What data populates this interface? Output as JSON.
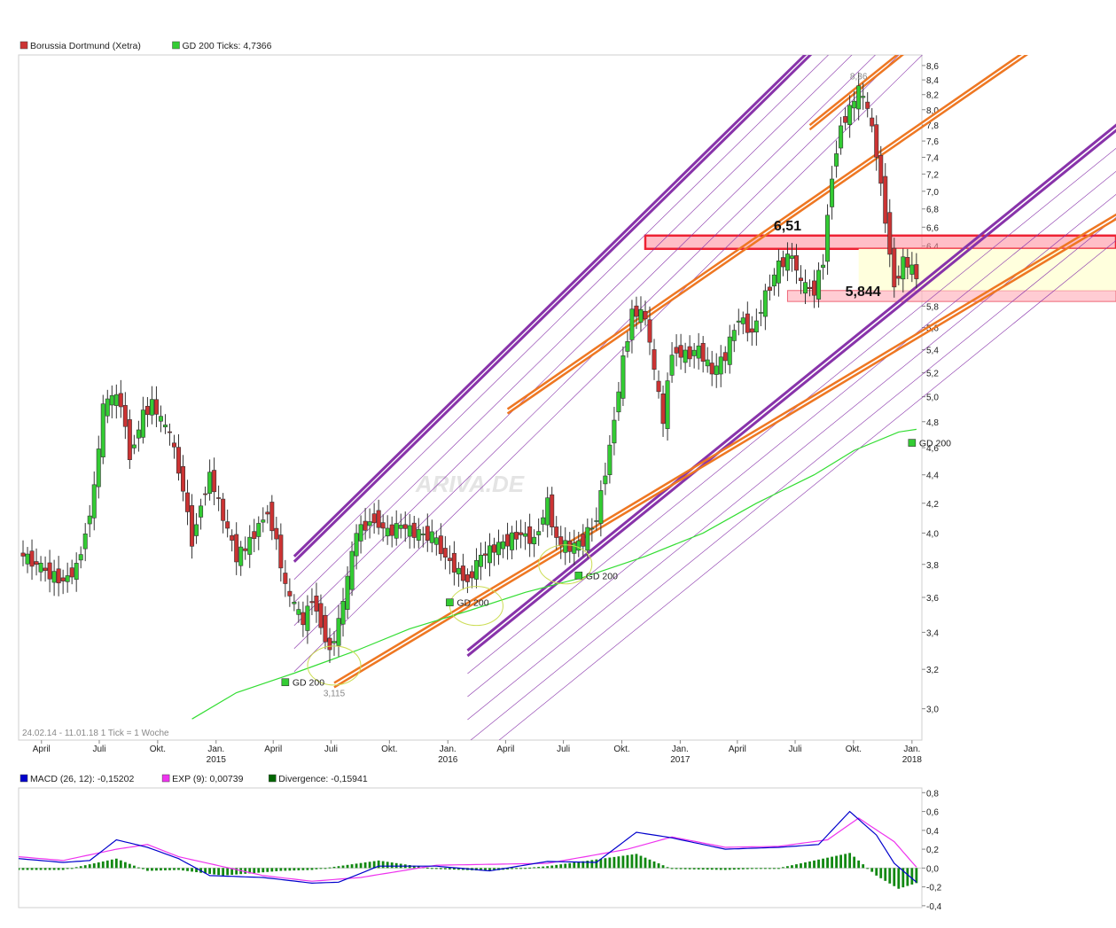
{
  "main_legend": [
    {
      "label": "Borussia Dortmund (Xetra)",
      "color": "#cc3333"
    },
    {
      "label": "GD 200 Ticks: 4,7366",
      "color": "#33cc33"
    }
  ],
  "macd_legend": [
    {
      "label": "MACD (26, 12): -0,15202",
      "color": "#0000cc"
    },
    {
      "label": "EXP (9): 0,00739",
      "color": "#ee33ee"
    },
    {
      "label": "Divergence: -0,15941",
      "color": "#006600"
    }
  ],
  "watermark": "ARIVA.DE",
  "footer_note": "24.02.14 - 11.01.18   1 Tick = 1 Woche",
  "colors": {
    "up": "#33cc33",
    "down": "#cc3333",
    "ma": "#33dd33",
    "channel": "#8833aa",
    "support": "#ee7722",
    "zone_red": "#ee2233",
    "zone_yellow": "#ffffdd",
    "macd": "#0000cc",
    "signal": "#ee33ee",
    "divergence": "#118811"
  },
  "chart_data": [
    {
      "type": "candlestick",
      "title": "Borussia Dortmund (Xetra)",
      "x_type": "weekly",
      "x_range": [
        "2014-02-24",
        "2018-01-11"
      ],
      "ylim": [
        2.85,
        8.75
      ],
      "y_scale": "log",
      "y_ticks": [
        "3,0",
        "3,2",
        "3,4",
        "3,6",
        "3,8",
        "4,0",
        "4,2",
        "4,4",
        "4,6",
        "4,8",
        "5,0",
        "5,2",
        "5,4",
        "5,6",
        "5,8",
        "6,0",
        "6,2",
        "6,4",
        "6,6",
        "6,8",
        "7,0",
        "7,2",
        "7,4",
        "7,6",
        "7,8",
        "8,0",
        "8,2",
        "8,4",
        "8,6"
      ],
      "x_ticks": [
        {
          "date": "2014-04-01",
          "label": "April",
          "year": ""
        },
        {
          "date": "2014-07-01",
          "label": "Juli",
          "year": ""
        },
        {
          "date": "2014-10-01",
          "label": "Okt.",
          "year": ""
        },
        {
          "date": "2015-01-01",
          "label": "Jan.",
          "year": "2015"
        },
        {
          "date": "2015-04-01",
          "label": "April",
          "year": ""
        },
        {
          "date": "2015-07-01",
          "label": "Juli",
          "year": ""
        },
        {
          "date": "2015-10-01",
          "label": "Okt.",
          "year": ""
        },
        {
          "date": "2016-01-01",
          "label": "Jan.",
          "year": "2016"
        },
        {
          "date": "2016-04-01",
          "label": "April",
          "year": ""
        },
        {
          "date": "2016-07-01",
          "label": "Juli",
          "year": ""
        },
        {
          "date": "2016-10-01",
          "label": "Okt.",
          "year": ""
        },
        {
          "date": "2017-01-01",
          "label": "Jan.",
          "year": "2017"
        },
        {
          "date": "2017-04-01",
          "label": "April",
          "year": ""
        },
        {
          "date": "2017-07-01",
          "label": "Juli",
          "year": ""
        },
        {
          "date": "2017-10-01",
          "label": "Okt.",
          "year": ""
        },
        {
          "date": "2018-01-01",
          "label": "Jan.",
          "year": "2018"
        }
      ],
      "series": [
        {
          "name": "Borussia Dortmund (Xetra)",
          "kind": "close",
          "points": [
            [
              "2014-02-24",
              3.87
            ],
            [
              "2014-03-24",
              3.8
            ],
            [
              "2014-04-14",
              3.74
            ],
            [
              "2014-05-05",
              3.7
            ],
            [
              "2014-05-26",
              3.78
            ],
            [
              "2014-06-09",
              4.0
            ],
            [
              "2014-06-23",
              4.3
            ],
            [
              "2014-07-07",
              4.9
            ],
            [
              "2014-07-21",
              5.0
            ],
            [
              "2014-08-04",
              4.95
            ],
            [
              "2014-08-18",
              4.55
            ],
            [
              "2014-09-08",
              4.85
            ],
            [
              "2014-09-22",
              4.95
            ],
            [
              "2014-10-06",
              4.8
            ],
            [
              "2014-10-20",
              4.7
            ],
            [
              "2014-11-10",
              4.3
            ],
            [
              "2014-11-24",
              3.95
            ],
            [
              "2014-12-08",
              4.2
            ],
            [
              "2014-12-22",
              4.4
            ],
            [
              "2015-01-12",
              4.1
            ],
            [
              "2015-02-02",
              3.85
            ],
            [
              "2015-02-16",
              3.9
            ],
            [
              "2015-03-09",
              4.05
            ],
            [
              "2015-03-23",
              4.15
            ],
            [
              "2015-04-06",
              3.95
            ],
            [
              "2015-04-20",
              3.65
            ],
            [
              "2015-05-04",
              3.55
            ],
            [
              "2015-05-18",
              3.45
            ],
            [
              "2015-06-01",
              3.6
            ],
            [
              "2015-06-15",
              3.45
            ],
            [
              "2015-06-29",
              3.3
            ],
            [
              "2015-07-13",
              3.45
            ],
            [
              "2015-07-27",
              3.7
            ],
            [
              "2015-08-10",
              4.0
            ],
            [
              "2015-08-24",
              4.05
            ],
            [
              "2015-09-07",
              4.1
            ],
            [
              "2015-09-28",
              4.0
            ],
            [
              "2015-10-19",
              4.05
            ],
            [
              "2015-11-09",
              4.0
            ],
            [
              "2015-12-07",
              3.98
            ],
            [
              "2015-12-28",
              3.85
            ],
            [
              "2016-01-18",
              3.75
            ],
            [
              "2016-02-01",
              3.7
            ],
            [
              "2016-02-22",
              3.85
            ],
            [
              "2016-03-14",
              3.9
            ],
            [
              "2016-04-04",
              3.95
            ],
            [
              "2016-04-25",
              4.0
            ],
            [
              "2016-05-16",
              3.95
            ],
            [
              "2016-06-06",
              4.2
            ],
            [
              "2016-06-20",
              3.95
            ],
            [
              "2016-07-11",
              3.9
            ],
            [
              "2016-08-01",
              3.95
            ],
            [
              "2016-08-22",
              4.1
            ],
            [
              "2016-09-12",
              4.6
            ],
            [
              "2016-10-03",
              5.3
            ],
            [
              "2016-10-17",
              5.75
            ],
            [
              "2016-11-07",
              5.7
            ],
            [
              "2016-11-21",
              5.2
            ],
            [
              "2016-12-05",
              4.8
            ],
            [
              "2016-12-19",
              5.4
            ],
            [
              "2017-01-09",
              5.35
            ],
            [
              "2017-01-30",
              5.4
            ],
            [
              "2017-02-20",
              5.2
            ],
            [
              "2017-03-13",
              5.35
            ],
            [
              "2017-04-03",
              5.7
            ],
            [
              "2017-04-24",
              5.55
            ],
            [
              "2017-05-15",
              5.9
            ],
            [
              "2017-06-05",
              6.2
            ],
            [
              "2017-06-26",
              6.3
            ],
            [
              "2017-07-10",
              6.0
            ],
            [
              "2017-07-31",
              5.95
            ],
            [
              "2017-08-14",
              6.25
            ],
            [
              "2017-08-28",
              7.2
            ],
            [
              "2017-09-11",
              7.8
            ],
            [
              "2017-09-25",
              8.0
            ],
            [
              "2017-10-09",
              8.25
            ],
            [
              "2017-10-23",
              8.0
            ],
            [
              "2017-11-06",
              7.45
            ],
            [
              "2017-11-20",
              6.7
            ],
            [
              "2017-12-04",
              6.0
            ],
            [
              "2017-12-18",
              6.25
            ],
            [
              "2018-01-08",
              6.1
            ]
          ]
        },
        {
          "name": "GD 200",
          "kind": "moving_average",
          "points": [
            [
              "2014-11-24",
              2.95
            ],
            [
              "2015-02-02",
              3.08
            ],
            [
              "2015-05-04",
              3.18
            ],
            [
              "2015-08-10",
              3.3
            ],
            [
              "2015-11-02",
              3.42
            ],
            [
              "2016-02-01",
              3.52
            ],
            [
              "2016-05-02",
              3.63
            ],
            [
              "2016-08-01",
              3.72
            ],
            [
              "2016-11-07",
              3.85
            ],
            [
              "2017-02-06",
              4.0
            ],
            [
              "2017-05-01",
              4.2
            ],
            [
              "2017-07-31",
              4.4
            ],
            [
              "2017-10-02",
              4.58
            ],
            [
              "2017-12-11",
              4.72
            ],
            [
              "2018-01-08",
              4.74
            ]
          ]
        }
      ],
      "annotations": [
        {
          "text": "6,51",
          "date": "2017-06-19",
          "value": 6.51,
          "style": "bold"
        },
        {
          "text": "5,844",
          "date": "2017-10-16",
          "value": 5.844,
          "style": "bold"
        },
        {
          "text": "8,36",
          "date": "2017-10-09",
          "value": 8.36,
          "style": "small"
        },
        {
          "text": "3,115",
          "date": "2015-07-06",
          "value": 3.115,
          "style": "small"
        },
        {
          "text": "GD 200",
          "date": "2015-04-20",
          "value": 3.115,
          "style": "tag"
        },
        {
          "text": "GD 200",
          "date": "2016-01-04",
          "value": 3.55,
          "style": "tag"
        },
        {
          "text": "GD 200",
          "date": "2016-07-25",
          "value": 3.71,
          "style": "tag"
        },
        {
          "text": "GD 200",
          "date": "2018-01-01",
          "value": 4.61,
          "style": "tag"
        }
      ],
      "zones": [
        {
          "kind": "resistance",
          "from": "2016-11-07",
          "low": 6.37,
          "high": 6.51
        },
        {
          "kind": "support",
          "from": "2017-06-19",
          "low": 5.844,
          "high": 5.95
        },
        {
          "kind": "range",
          "from": "2017-10-09",
          "low": 5.95,
          "high": 6.37
        }
      ],
      "trendlines": [
        {
          "kind": "channel",
          "from": [
            "2015-05-04",
            3.85
          ],
          "to": [
            "2018-01-11",
            10.5
          ]
        },
        {
          "kind": "channel",
          "from": [
            "2016-02-01",
            3.3
          ],
          "to": [
            "2018-01-11",
            6.0
          ]
        },
        {
          "kind": "support",
          "from": [
            "2015-07-06",
            3.13
          ],
          "to": [
            "2018-01-11",
            5.55
          ]
        },
        {
          "kind": "support",
          "from": [
            "2016-04-04",
            4.9
          ],
          "to": [
            "2018-01-11",
            7.8
          ]
        },
        {
          "kind": "support",
          "from": [
            "2017-07-24",
            7.8
          ],
          "to": [
            "2018-01-11",
            9.0
          ]
        }
      ],
      "circles": [
        {
          "date": "2015-07-06",
          "value": 3.22
        },
        {
          "date": "2016-02-15",
          "value": 3.55
        },
        {
          "date": "2016-07-04",
          "value": 3.8
        }
      ]
    },
    {
      "type": "macd",
      "title": "MACD (26, 12)",
      "ylim": [
        -0.42,
        0.85
      ],
      "y_ticks": [
        "0,8",
        "0,6",
        "0,4",
        "0,2",
        "0,0",
        "-0,2",
        "-0,4"
      ],
      "series": [
        {
          "name": "MACD (26, 12)",
          "points": [
            [
              "2014-02-24",
              0.1
            ],
            [
              "2014-05-05",
              0.06
            ],
            [
              "2014-06-16",
              0.08
            ],
            [
              "2014-07-28",
              0.3
            ],
            [
              "2014-09-15",
              0.22
            ],
            [
              "2014-11-03",
              0.1
            ],
            [
              "2014-12-22",
              -0.08
            ],
            [
              "2015-03-16",
              -0.1
            ],
            [
              "2015-06-01",
              -0.16
            ],
            [
              "2015-07-13",
              -0.15
            ],
            [
              "2015-09-14",
              0.02
            ],
            [
              "2015-12-14",
              0.02
            ],
            [
              "2016-03-07",
              -0.03
            ],
            [
              "2016-06-06",
              0.07
            ],
            [
              "2016-08-22",
              0.06
            ],
            [
              "2016-10-24",
              0.38
            ],
            [
              "2016-12-19",
              0.32
            ],
            [
              "2017-03-13",
              0.2
            ],
            [
              "2017-06-05",
              0.22
            ],
            [
              "2017-08-07",
              0.25
            ],
            [
              "2017-09-25",
              0.6
            ],
            [
              "2017-11-06",
              0.35
            ],
            [
              "2017-12-04",
              0.05
            ],
            [
              "2018-01-08",
              -0.15
            ]
          ]
        },
        {
          "name": "EXP (9)",
          "points": [
            [
              "2014-02-24",
              0.12
            ],
            [
              "2014-05-05",
              0.08
            ],
            [
              "2014-07-28",
              0.2
            ],
            [
              "2014-09-15",
              0.25
            ],
            [
              "2014-11-03",
              0.12
            ],
            [
              "2015-03-16",
              -0.08
            ],
            [
              "2015-06-01",
              -0.14
            ],
            [
              "2015-08-17",
              -0.1
            ],
            [
              "2015-12-14",
              0.03
            ],
            [
              "2016-06-06",
              0.05
            ],
            [
              "2016-10-10",
              0.2
            ],
            [
              "2016-12-19",
              0.33
            ],
            [
              "2017-03-13",
              0.22
            ],
            [
              "2017-06-05",
              0.23
            ],
            [
              "2017-08-21",
              0.3
            ],
            [
              "2017-10-09",
              0.53
            ],
            [
              "2017-12-04",
              0.28
            ],
            [
              "2018-01-08",
              0.01
            ]
          ]
        },
        {
          "name": "Divergence",
          "kind": "histogram",
          "points": [
            [
              "2014-02-24",
              -0.02
            ],
            [
              "2014-05-05",
              -0.02
            ],
            [
              "2014-07-28",
              0.1
            ],
            [
              "2014-09-15",
              -0.03
            ],
            [
              "2014-11-03",
              -0.02
            ],
            [
              "2015-01-12",
              -0.08
            ],
            [
              "2015-04-13",
              -0.03
            ],
            [
              "2015-06-01",
              -0.02
            ],
            [
              "2015-09-14",
              0.08
            ],
            [
              "2015-12-14",
              -0.01
            ],
            [
              "2016-03-07",
              -0.03
            ],
            [
              "2016-06-06",
              0.02
            ],
            [
              "2016-10-24",
              0.15
            ],
            [
              "2016-12-19",
              -0.01
            ],
            [
              "2017-03-13",
              -0.02
            ],
            [
              "2017-06-05",
              0.0
            ],
            [
              "2017-09-25",
              0.16
            ],
            [
              "2017-11-06",
              -0.08
            ],
            [
              "2017-12-11",
              -0.22
            ],
            [
              "2018-01-08",
              -0.16
            ]
          ]
        }
      ]
    }
  ]
}
